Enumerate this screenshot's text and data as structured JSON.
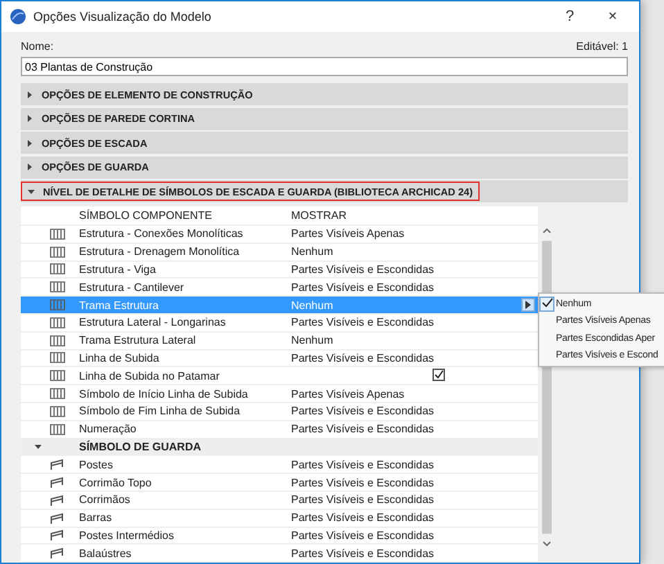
{
  "window": {
    "title": "Opções Visualização do Modelo",
    "help": "?",
    "close": "×"
  },
  "name_field": {
    "label": "Nome:",
    "value": "03 Plantas de Construção"
  },
  "editable": "Editável: 1",
  "sections": [
    {
      "label": "OPÇÕES DE ELEMENTO DE CONSTRUÇÃO",
      "expanded": false,
      "highlighted": false
    },
    {
      "label": "OPÇÕES DE PAREDE CORTINA",
      "expanded": false,
      "highlighted": false
    },
    {
      "label": "OPÇÕES DE ESCADA",
      "expanded": false,
      "highlighted": false
    },
    {
      "label": "OPÇÕES DE GUARDA",
      "expanded": false,
      "highlighted": false
    },
    {
      "label": "NÍVEL DE DETALHE DE SÍMBOLOS DE ESCADA E GUARDA (BIBLIOTECA ARCHICAD 24)",
      "expanded": true,
      "highlighted": true
    }
  ],
  "table": {
    "columns": [
      "SÍMBOLO COMPONENTE",
      "MOSTRAR"
    ],
    "rows": [
      {
        "kind": "option",
        "name": "Estrutura - Conexões Monolíticas",
        "value": "Partes Visíveis Apenas",
        "selected": false
      },
      {
        "kind": "option",
        "name": "Estrutura - Drenagem Monolítica",
        "value": "Nenhum",
        "selected": false
      },
      {
        "kind": "option",
        "name": "Estrutura - Viga",
        "value": "Partes Visíveis e Escondidas",
        "selected": false
      },
      {
        "kind": "option",
        "name": "Estrutura - Cantilever",
        "value": "Partes Visíveis e Escondidas",
        "selected": false
      },
      {
        "kind": "option",
        "name": "Trama Estrutura",
        "value": "Nenhum",
        "selected": true
      },
      {
        "kind": "option",
        "name": "Estrutura Lateral - Longarinas",
        "value": "Partes Visíveis e Escondidas",
        "selected": false
      },
      {
        "kind": "option",
        "name": "Trama Estrutura Lateral",
        "value": "Nenhum",
        "selected": false
      },
      {
        "kind": "option",
        "name": "Linha de Subida",
        "value": "Partes Visíveis e Escondidas",
        "selected": false
      },
      {
        "kind": "checkbox",
        "name": "Linha de Subida no Patamar",
        "checked": true,
        "selected": false
      },
      {
        "kind": "option",
        "name": "Símbolo de Início Linha de Subida",
        "value": "Partes Visíveis Apenas",
        "selected": false
      },
      {
        "kind": "option",
        "name": "Símbolo de Fim Linha de Subida",
        "value": "Partes Visíveis e Escondidas",
        "selected": false
      },
      {
        "kind": "option",
        "name": "Numeração",
        "value": "Partes Visíveis e Escondidas",
        "selected": false
      },
      {
        "kind": "group",
        "name": "SÍMBOLO DE GUARDA",
        "expanded": true
      },
      {
        "kind": "option",
        "name": "Postes",
        "value": "Partes Visíveis e Escondidas",
        "selected": false
      },
      {
        "kind": "option",
        "name": "Corrimão Topo",
        "value": "Partes Visíveis e Escondidas",
        "selected": false
      },
      {
        "kind": "option",
        "name": "Corrimãos",
        "value": "Partes Visíveis e Escondidas",
        "selected": false
      },
      {
        "kind": "option",
        "name": "Barras",
        "value": "Partes Visíveis e Escondidas",
        "selected": false
      },
      {
        "kind": "option",
        "name": "Postes Intermédios",
        "value": "Partes Visíveis e Escondidas",
        "selected": false
      },
      {
        "kind": "option",
        "name": "Balaústres",
        "value": "Partes Visíveis e Escondidas",
        "selected": false
      }
    ]
  },
  "dropdown_menu": {
    "items": [
      {
        "label": "Nenhum",
        "selected": true
      },
      {
        "label": "Partes Visíveis Apenas",
        "selected": false
      },
      {
        "label": "Partes Escondidas Aper",
        "selected": false
      },
      {
        "label": "Partes Visíveis e Escond",
        "selected": false
      }
    ]
  }
}
